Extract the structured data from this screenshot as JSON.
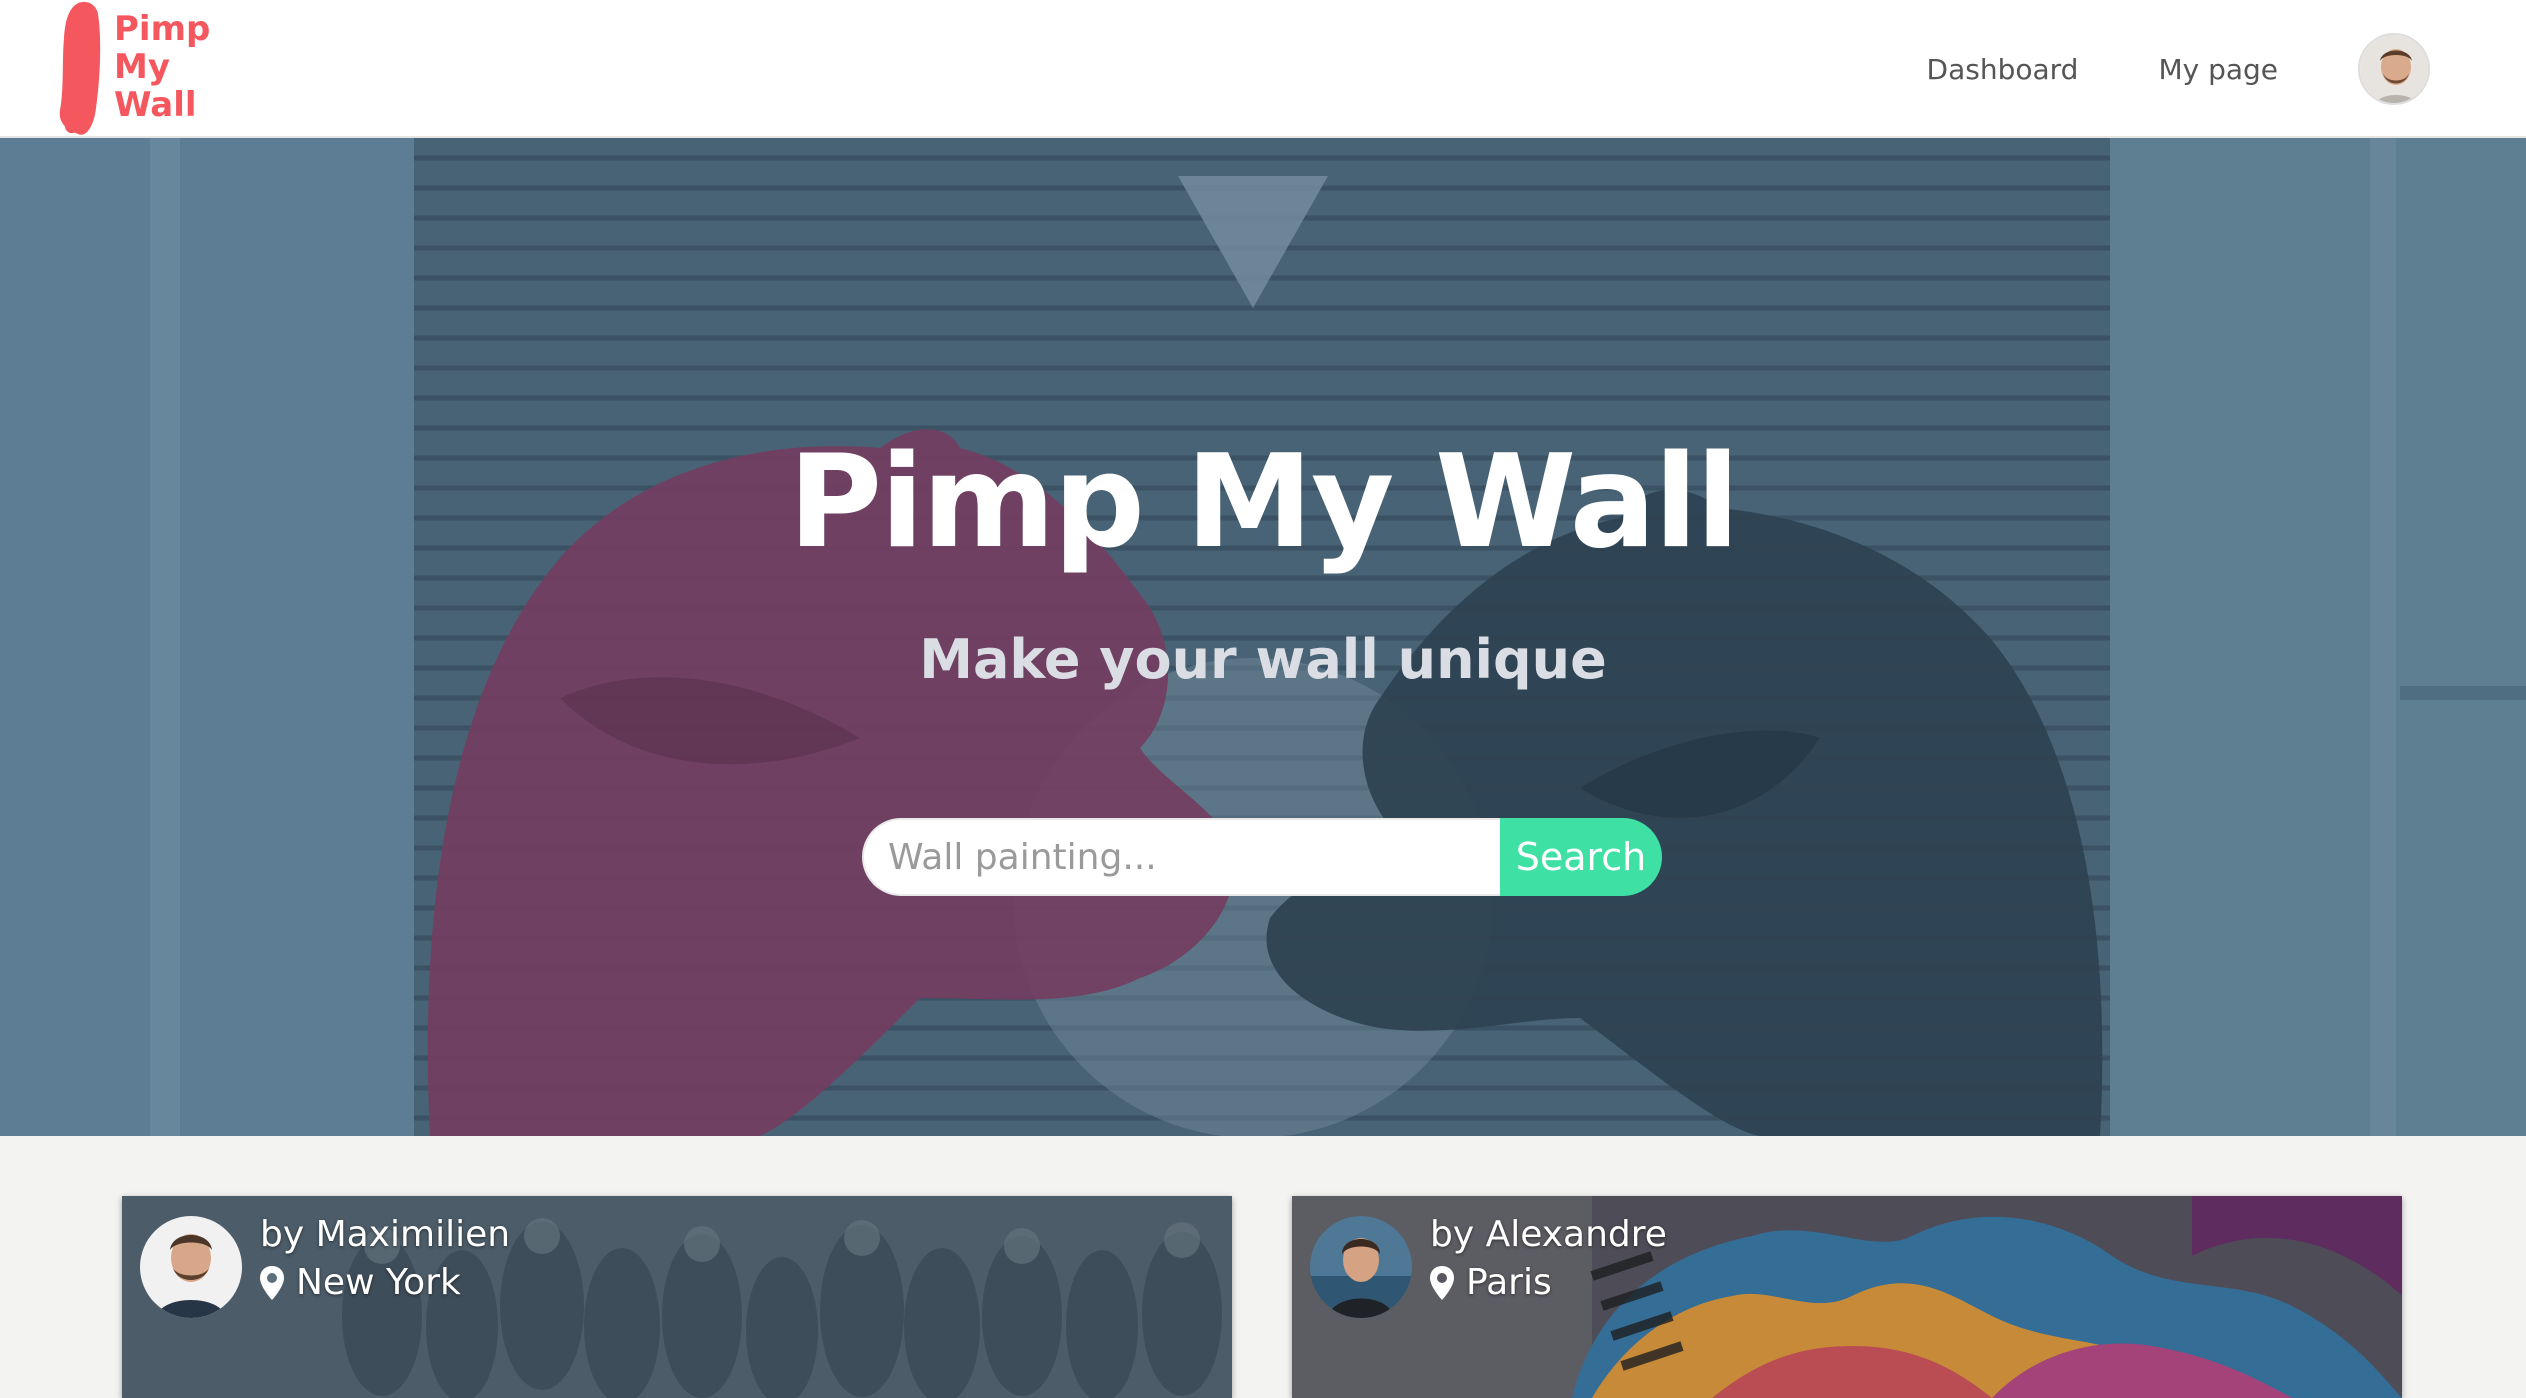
{
  "header": {
    "logo_lines": [
      "Pimp",
      "My",
      "Wall"
    ],
    "nav": {
      "dashboard": "Dashboard",
      "my_page": "My page"
    },
    "avatar_icon": "user-avatar"
  },
  "hero": {
    "title": "Pimp My Wall",
    "subtitle": "Make your wall unique",
    "search": {
      "placeholder": "Wall painting...",
      "value": "",
      "button_label": "Search"
    }
  },
  "cards": [
    {
      "author": "by Maximilien",
      "location": "New York",
      "icon": "map-pin-icon"
    },
    {
      "author": "by Alexandre",
      "location": "Paris",
      "icon": "map-pin-icon"
    }
  ],
  "colors": {
    "brand": "#f4575e",
    "accent": "#3fe0a4",
    "hero_overlay": "#5d7a8e"
  }
}
